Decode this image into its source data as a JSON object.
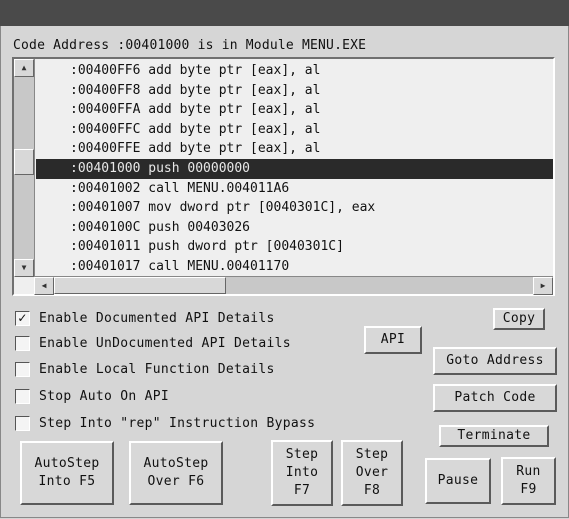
{
  "header": {
    "text": "Code Address :00401000 is in Module MENU.EXE"
  },
  "code_lines": [
    ":00400FF6 add byte ptr [eax], al",
    ":00400FF8 add byte ptr [eax], al",
    ":00400FFA add byte ptr [eax], al",
    ":00400FFC add byte ptr [eax], al",
    ":00400FFE add byte ptr [eax], al",
    ":00401000 push 00000000",
    ":00401002 call MENU.004011A6",
    ":00401007 mov dword ptr [0040301C], eax",
    ":0040100C push 00403026",
    ":00401011 push dword ptr [0040301C]",
    ":00401017 call MENU.00401170"
  ],
  "selected_line_index": 5,
  "options": [
    {
      "label": "Enable Documented API Details",
      "checked": true
    },
    {
      "label": "Enable UnDocumented API Details",
      "checked": false
    },
    {
      "label": "Enable Local Function Details",
      "checked": false
    },
    {
      "label": "Stop Auto On API",
      "checked": false
    },
    {
      "label": "Step Into \"rep\" Instruction Bypass",
      "checked": false
    }
  ],
  "checkmark_glyph": "✓",
  "buttons": {
    "copy": "Copy",
    "api": "API",
    "goto_address": "Goto Address",
    "patch_code": "Patch Code",
    "terminate": "Terminate",
    "autostep_into": "AutoStep\nInto F5",
    "autostep_over": "AutoStep\nOver F6",
    "step_into": "Step\nInto\nF7",
    "step_over": "Step\nOver\nF8",
    "pause": "Pause",
    "run": "Run\nF9"
  },
  "icons": {
    "scroll_up": "▲",
    "scroll_down": "▼",
    "scroll_left": "◀",
    "scroll_right": "▶"
  },
  "colors": {
    "selected_row_bg": "#2a2a2a",
    "panel_bg": "#efefef",
    "window_bg": "#d6d6d6",
    "titlebar": "#4a4a4a"
  }
}
